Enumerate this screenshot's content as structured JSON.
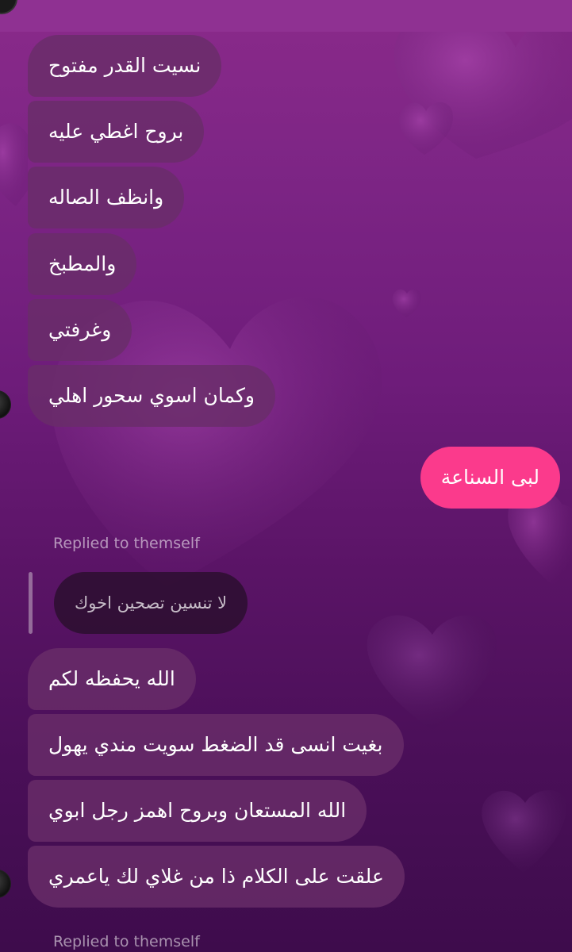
{
  "conversation": {
    "messages_group_1": [
      "نسيت القدر مفتوح",
      "بروح اغطي عليه",
      "وانظف الصاله",
      "والمطبخ",
      "وغرفتي",
      "وكمان اسوي سحور اهلي"
    ],
    "outgoing_message": "لبى السناعة",
    "reply_1": {
      "replied_label": "Replied to themself",
      "quoted_text": "لا تنسين تصحين اخوك"
    },
    "messages_group_2": [
      "الله يحفظه لكم",
      "بغيت انسى قد الضغط سويت مندي يهول",
      "الله المستعان وبروح اهمز رجل ابوي",
      "علقت على الكلام ذا من غلاي لك ياعمري"
    ],
    "reply_2": {
      "replied_label": "Replied to themself"
    }
  },
  "theme": {
    "outgoing_bubble_color": "#fb3a8c",
    "incoming_bubble_color": "#692d69",
    "background_top": "#8a2a8a",
    "background_bottom": "#3e0c4c"
  }
}
